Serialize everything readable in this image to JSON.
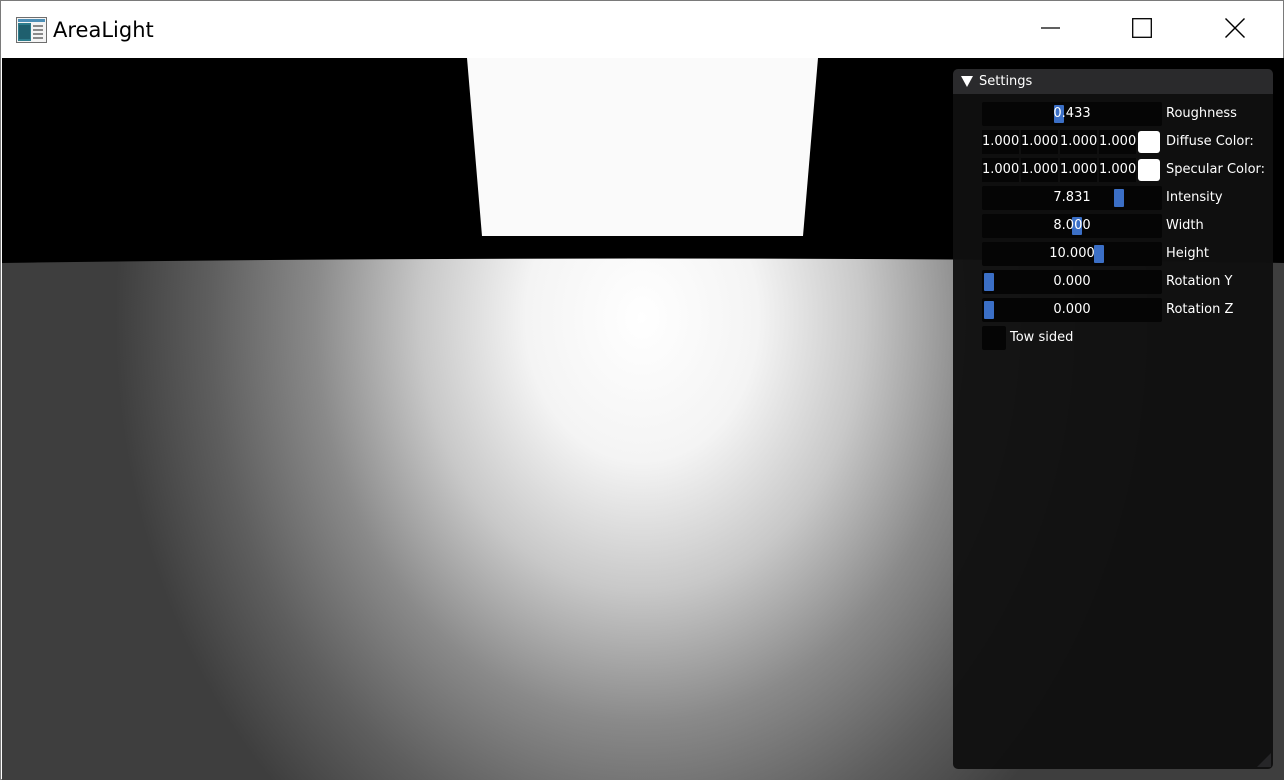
{
  "window": {
    "title": "AreaLight",
    "icons": {
      "app": "app-window-icon",
      "minimize": "minimize-icon",
      "maximize": "maximize-icon",
      "close": "close-icon"
    }
  },
  "panel": {
    "header": "Settings",
    "roughness": {
      "label": "Roughness",
      "value": "0.433",
      "fraction": 0.433
    },
    "diffuse": {
      "label": "Diffuse Color:",
      "r": "1.000",
      "g": "1.000",
      "b": "1.000",
      "a": "1.000",
      "swatch": "#ffffff"
    },
    "specular": {
      "label": "Specular Color:",
      "r": "1.000",
      "g": "1.000",
      "b": "1.000",
      "a": "1.000",
      "swatch": "#ffffff"
    },
    "intensity": {
      "label": "Intensity",
      "value": "7.831",
      "fraction": 0.78
    },
    "width": {
      "label": "Width",
      "value": "8.000",
      "fraction": 0.53
    },
    "height": {
      "label": "Height",
      "value": "10.000",
      "fraction": 0.66
    },
    "rotation_y": {
      "label": "Rotation Y",
      "value": "0.000",
      "fraction": 0.0
    },
    "rotation_z": {
      "label": "Rotation Z",
      "value": "0.000",
      "fraction": 0.0
    },
    "two_sided": {
      "label": "Tow sided",
      "checked": false
    }
  },
  "colors": {
    "accent": "#3b6fc6",
    "panel_bg": "#101010",
    "header_bg": "#2a2a2c",
    "frame_bg": "#050505"
  }
}
